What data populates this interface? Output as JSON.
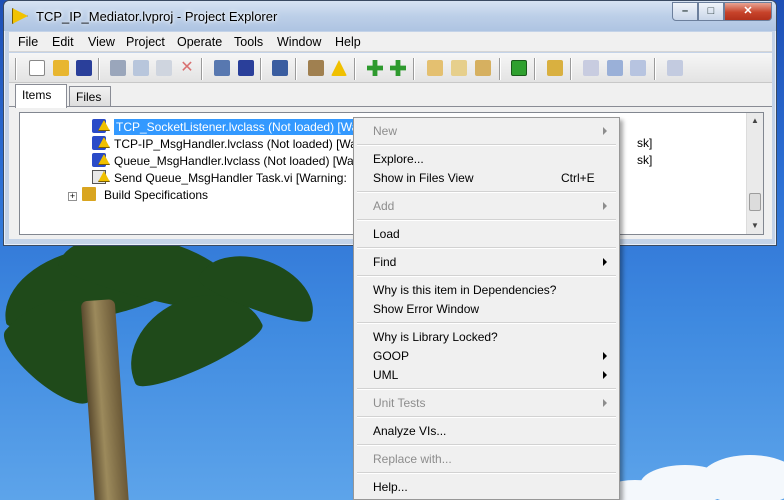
{
  "window": {
    "title": "TCP_IP_Mediator.lvproj - Project Explorer",
    "controls": {
      "minimize": "–",
      "maximize": "□",
      "close": "✕"
    }
  },
  "menubar": {
    "items": [
      "File",
      "Edit",
      "View",
      "Project",
      "Operate",
      "Tools",
      "Window",
      "Help"
    ]
  },
  "toolbar": {
    "icons": [
      "new-icon",
      "open-icon",
      "save-all-icon",
      "cut-icon",
      "copy-icon",
      "paste-icon",
      "delete-icon",
      "project-icon",
      "save-icon",
      "build-icon",
      "add-item-icon",
      "warning-icon",
      "run-icon",
      "add-icon",
      "collapse-icon",
      "expand-icon",
      "sort-icon",
      "package-icon",
      "uml-icon",
      "check-icon",
      "undo-icon",
      "redo-icon",
      "deploy-icon"
    ]
  },
  "tabs": {
    "items": "Items",
    "files": "Files"
  },
  "tree": {
    "rows": [
      {
        "label": "TCP_SocketListener.lvclass (Not loaded)  [Warning: ... load ... to disk]",
        "selected": true
      },
      {
        "label": "TCP-IP_MsgHandler.lvclass (Not loaded)  [Wa",
        "suffix": "sk]"
      },
      {
        "label": "Queue_MsgHandler.lvclass (Not loaded)  [Wa",
        "suffix": "sk]"
      },
      {
        "label": "Send Queue_MsgHandler Task.vi  [Warning:"
      },
      {
        "label": "Build Specifications"
      }
    ]
  },
  "context_menu": {
    "items": [
      {
        "label": "New",
        "disabled": true,
        "submenu": true
      },
      {
        "label": "Explore...",
        "disabled": false
      },
      {
        "label": "Show in Files View",
        "shortcut": "Ctrl+E",
        "disabled": false
      },
      {
        "label": "Add",
        "disabled": true,
        "submenu": true
      },
      {
        "label": "Load",
        "disabled": false
      },
      {
        "label": "Find",
        "disabled": false,
        "submenu": true
      },
      {
        "label": "Why is this item in Dependencies?",
        "disabled": false
      },
      {
        "label": "Show Error Window",
        "disabled": false
      },
      {
        "label": "Why is Library Locked?",
        "disabled": false
      },
      {
        "label": "GOOP",
        "disabled": false,
        "submenu": true
      },
      {
        "label": "UML",
        "disabled": false,
        "submenu": true
      },
      {
        "label": "Unit Tests",
        "disabled": true,
        "submenu": true
      },
      {
        "label": "Analyze VIs...",
        "disabled": false
      },
      {
        "label": "Replace with...",
        "disabled": true
      },
      {
        "label": "Help...",
        "disabled": false
      }
    ]
  },
  "colors": {
    "selection": "#3399ff",
    "titlebar": "#bccfe8",
    "menu_bg": "#f0f0f0",
    "disabled_text": "#8d8d8d"
  }
}
